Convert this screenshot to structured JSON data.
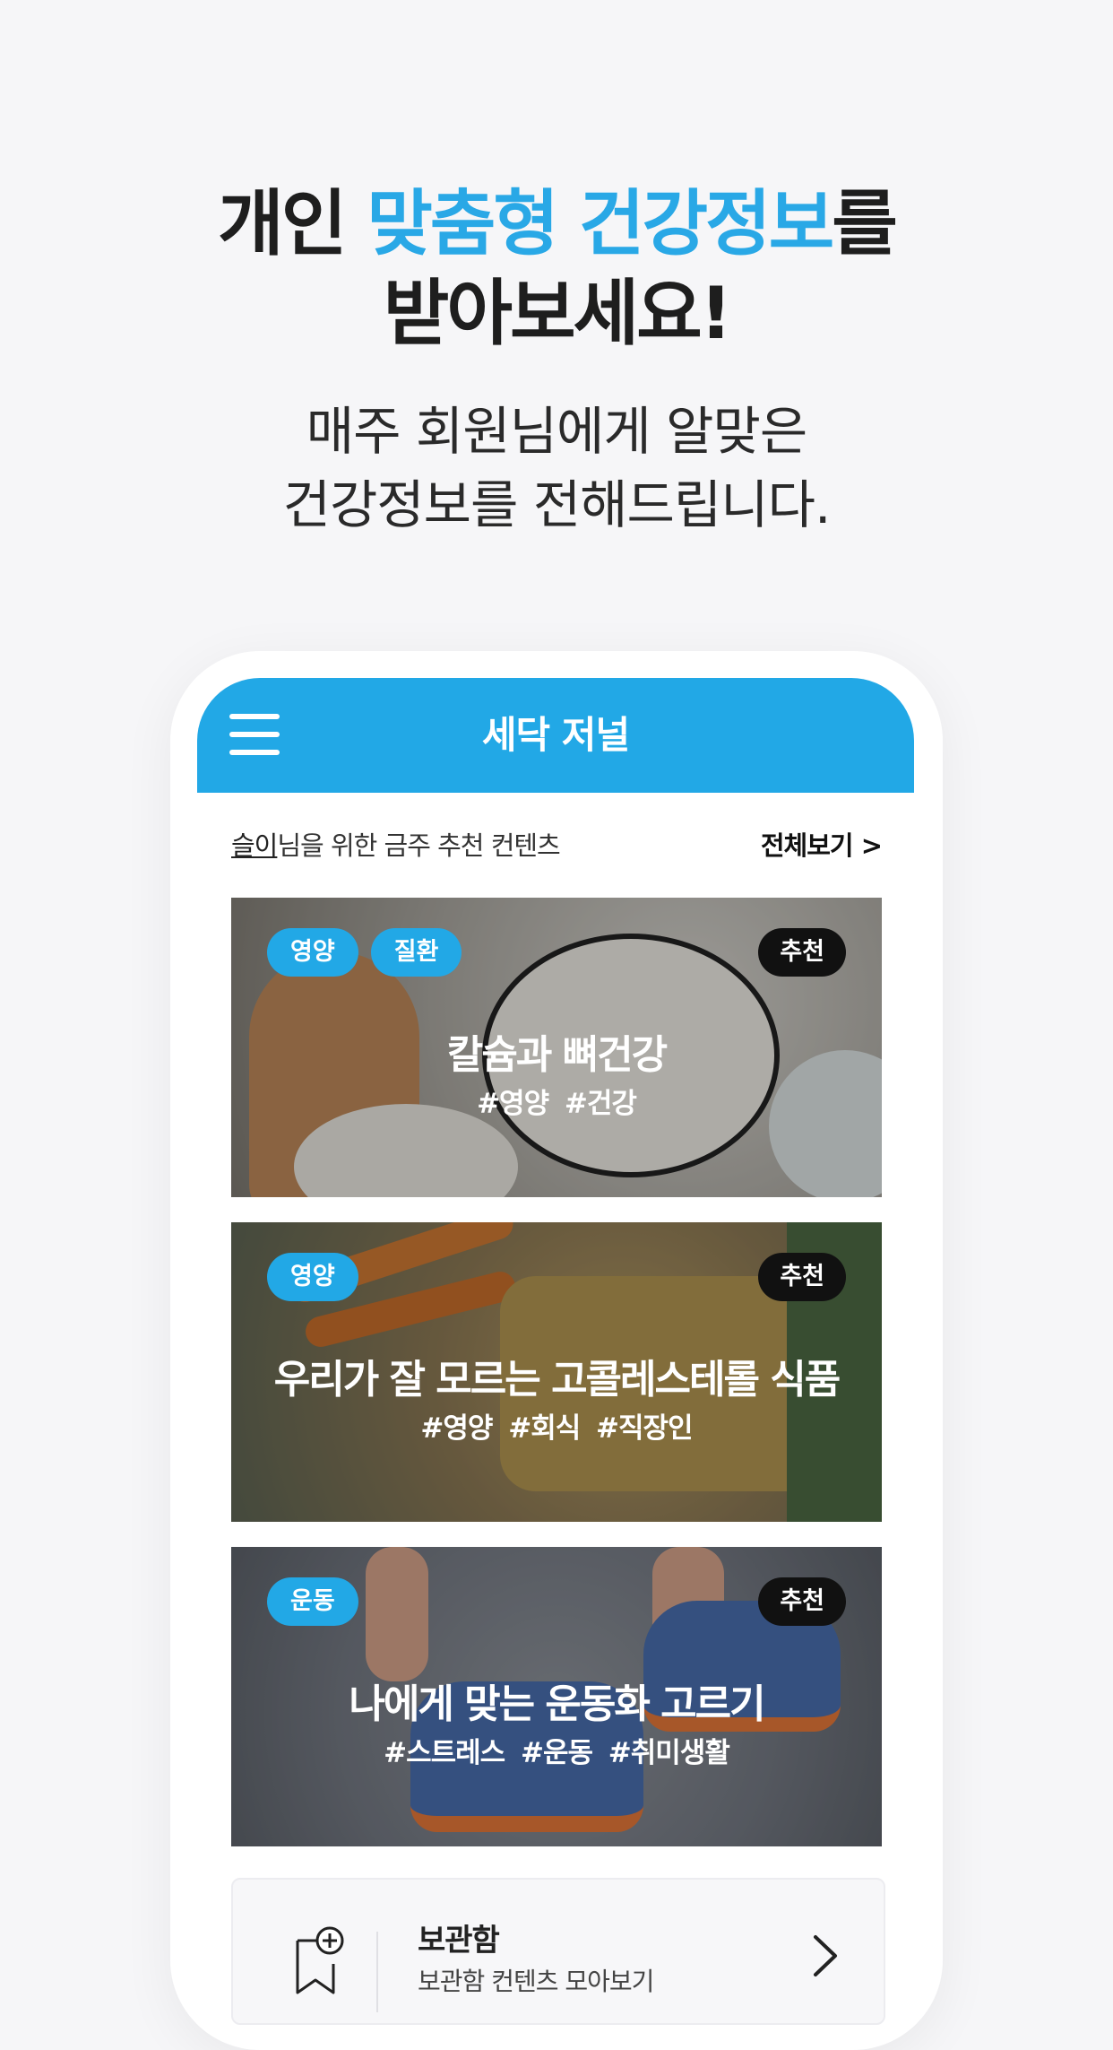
{
  "headline": {
    "part1": "개인 ",
    "accent": "맞춤형 건강정보",
    "part2": "를",
    "line2": "받아보세요!"
  },
  "subline": {
    "line1": "매주 회원님에게 알맞은",
    "line2": "건강정보를 전해드립니다."
  },
  "app": {
    "title": "세닥 저널",
    "recommend": {
      "user": "슬이",
      "suffix": "님을 위한 금주 추천 컨텐츠",
      "see_all": "전체보기 >"
    },
    "cards": [
      {
        "tags": [
          "영양",
          "질환"
        ],
        "badge": "추천",
        "title": "칼슘과 뼈건강",
        "hashtags": "#영양 #건강"
      },
      {
        "tags": [
          "영양"
        ],
        "badge": "추천",
        "title": "우리가 잘 모르는 고콜레스테롤 식품",
        "hashtags": "#영양 #회식 #직장인"
      },
      {
        "tags": [
          "운동"
        ],
        "badge": "추천",
        "title": "나에게 맞는 운동화 고르기",
        "hashtags": "#스트레스 #운동 #취미생활"
      }
    ],
    "storage": {
      "title": "보관함",
      "subtitle": "보관함 컨텐츠 모아보기"
    }
  },
  "colors": {
    "accent": "#29a8e6",
    "header": "#22a8e6",
    "badge": "#111111"
  },
  "icons": {
    "menu": "hamburger-icon",
    "storage": "bookmark-add-icon",
    "chevron": "chevron-right-icon"
  }
}
